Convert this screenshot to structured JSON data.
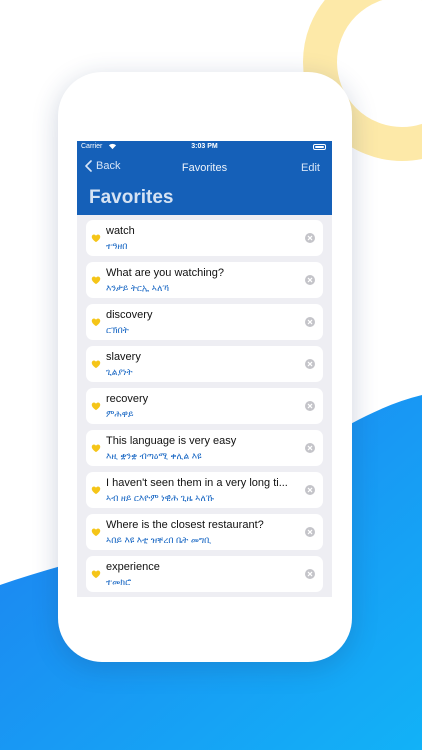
{
  "status_bar": {
    "carrier": "Carrier",
    "time": "3:03 PM"
  },
  "nav": {
    "back_label": "Back",
    "title": "Favorites",
    "edit_label": "Edit",
    "large_title": "Favorites"
  },
  "colors": {
    "nav_blue": "#1560b8",
    "heart_yellow": "#f5c518",
    "translation_blue": "#1a68c4",
    "accent_sky": "#1ba6f2",
    "circle_yellow": "#fde9a8"
  },
  "favorites": [
    {
      "word": "watch",
      "translation": "ተዓዘበ"
    },
    {
      "word": "What are you watching?",
      "translation": "እንታይ ትርኢ ኣለኻ"
    },
    {
      "word": "discovery",
      "translation": "ርኽበት"
    },
    {
      "word": "slavery",
      "translation": "ጊልያነት"
    },
    {
      "word": "recovery",
      "translation": "ምሕዋይ"
    },
    {
      "word": "This language is very easy",
      "translation": "እዚ ቋንቋ ብጣዕሚ ቀሊል እዩ"
    },
    {
      "word": "I haven't seen them in a very long ti...",
      "translation": "ኣብ ዘይ ርእዮም ነዊሕ ጊዜ ኣለኹ"
    },
    {
      "word": "Where is the closest restaurant?",
      "translation": "ኣበይ እዩ እቲ ዝቐረበ ቤት መግቢ"
    },
    {
      "word": "experience",
      "translation": "ተመክሮ"
    }
  ]
}
